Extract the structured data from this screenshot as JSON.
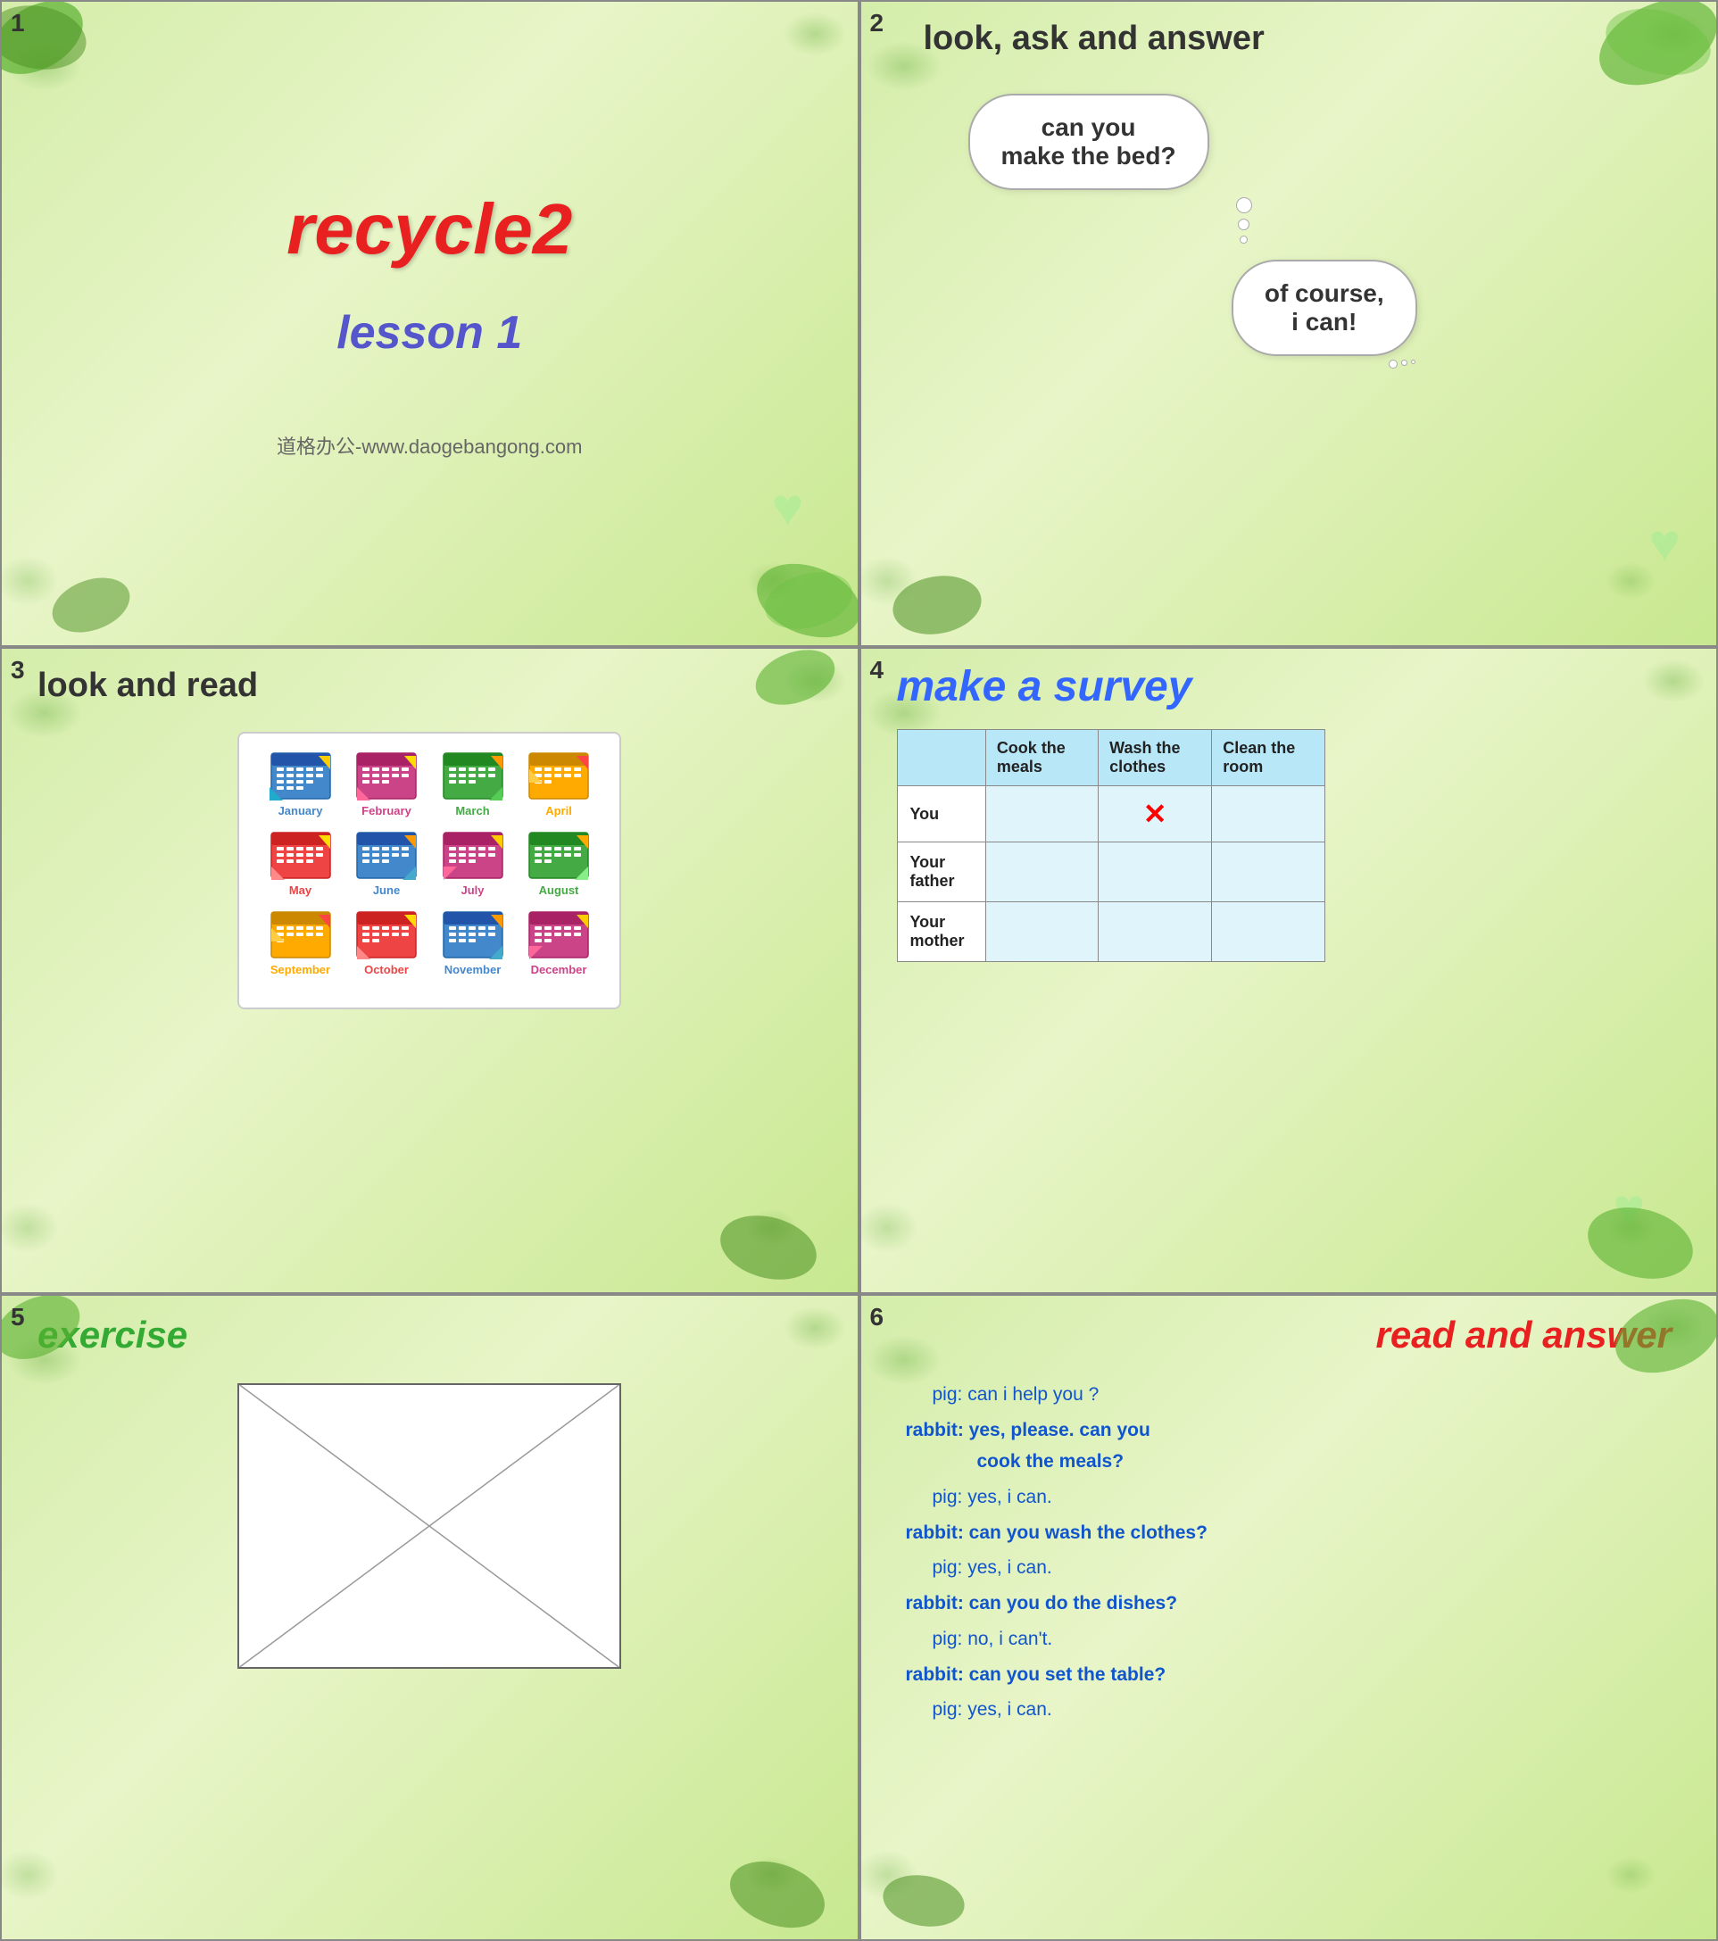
{
  "panels": {
    "panel1": {
      "number": "1",
      "title": "recycle2",
      "subtitle": "lesson 1",
      "watermark": "道格办公-www.daogebangong.com"
    },
    "panel2": {
      "number": "2",
      "header": "look, ask and answer",
      "bubble1": "can you\nmake the bed?",
      "bubble2": "of course,\ni can!"
    },
    "panel3": {
      "number": "3",
      "header": "look and read",
      "months_row1": [
        "January",
        "February",
        "March",
        "April"
      ],
      "months_row2": [
        "May",
        "June",
        "July",
        "August"
      ],
      "months_row3": [
        "September",
        "October",
        "November",
        "December"
      ],
      "colors_row1": [
        "#4488cc",
        "#cc4488",
        "#44aa44",
        "#ffaa00"
      ],
      "colors_row2": [
        "#ee4444",
        "#4488cc",
        "#cc4488",
        "#44aa44"
      ],
      "colors_row3": [
        "#ffaa00",
        "#ee4444",
        "#4488cc",
        "#cc4488"
      ]
    },
    "panel4": {
      "number": "4",
      "header": "make a survey",
      "col_headers": [
        "",
        "Cook the meals",
        "Wash the clothes",
        "Clean the room"
      ],
      "row_labels": [
        "You",
        "Your father",
        "Your mother"
      ],
      "x_mark": "✕"
    },
    "panel5": {
      "number": "5",
      "header": "exercise"
    },
    "panel6": {
      "number": "6",
      "header": "read and answer",
      "dialogue": [
        {
          "speaker": "pig",
          "text": "can i help you ?"
        },
        {
          "speaker": "rabbit",
          "text": "yes, please. can you cook the meals?"
        },
        {
          "speaker": "pig",
          "text": "yes, i can."
        },
        {
          "speaker": "rabbit",
          "text": "can you wash the clothes?"
        },
        {
          "speaker": "pig",
          "text": "yes, i can."
        },
        {
          "speaker": "rabbit",
          "text": "can you do the dishes?"
        },
        {
          "speaker": "pig",
          "text": "no, i can't."
        },
        {
          "speaker": "rabbit",
          "text": "can you set the table?"
        },
        {
          "speaker": "pig",
          "text": "yes, i can."
        }
      ]
    }
  }
}
